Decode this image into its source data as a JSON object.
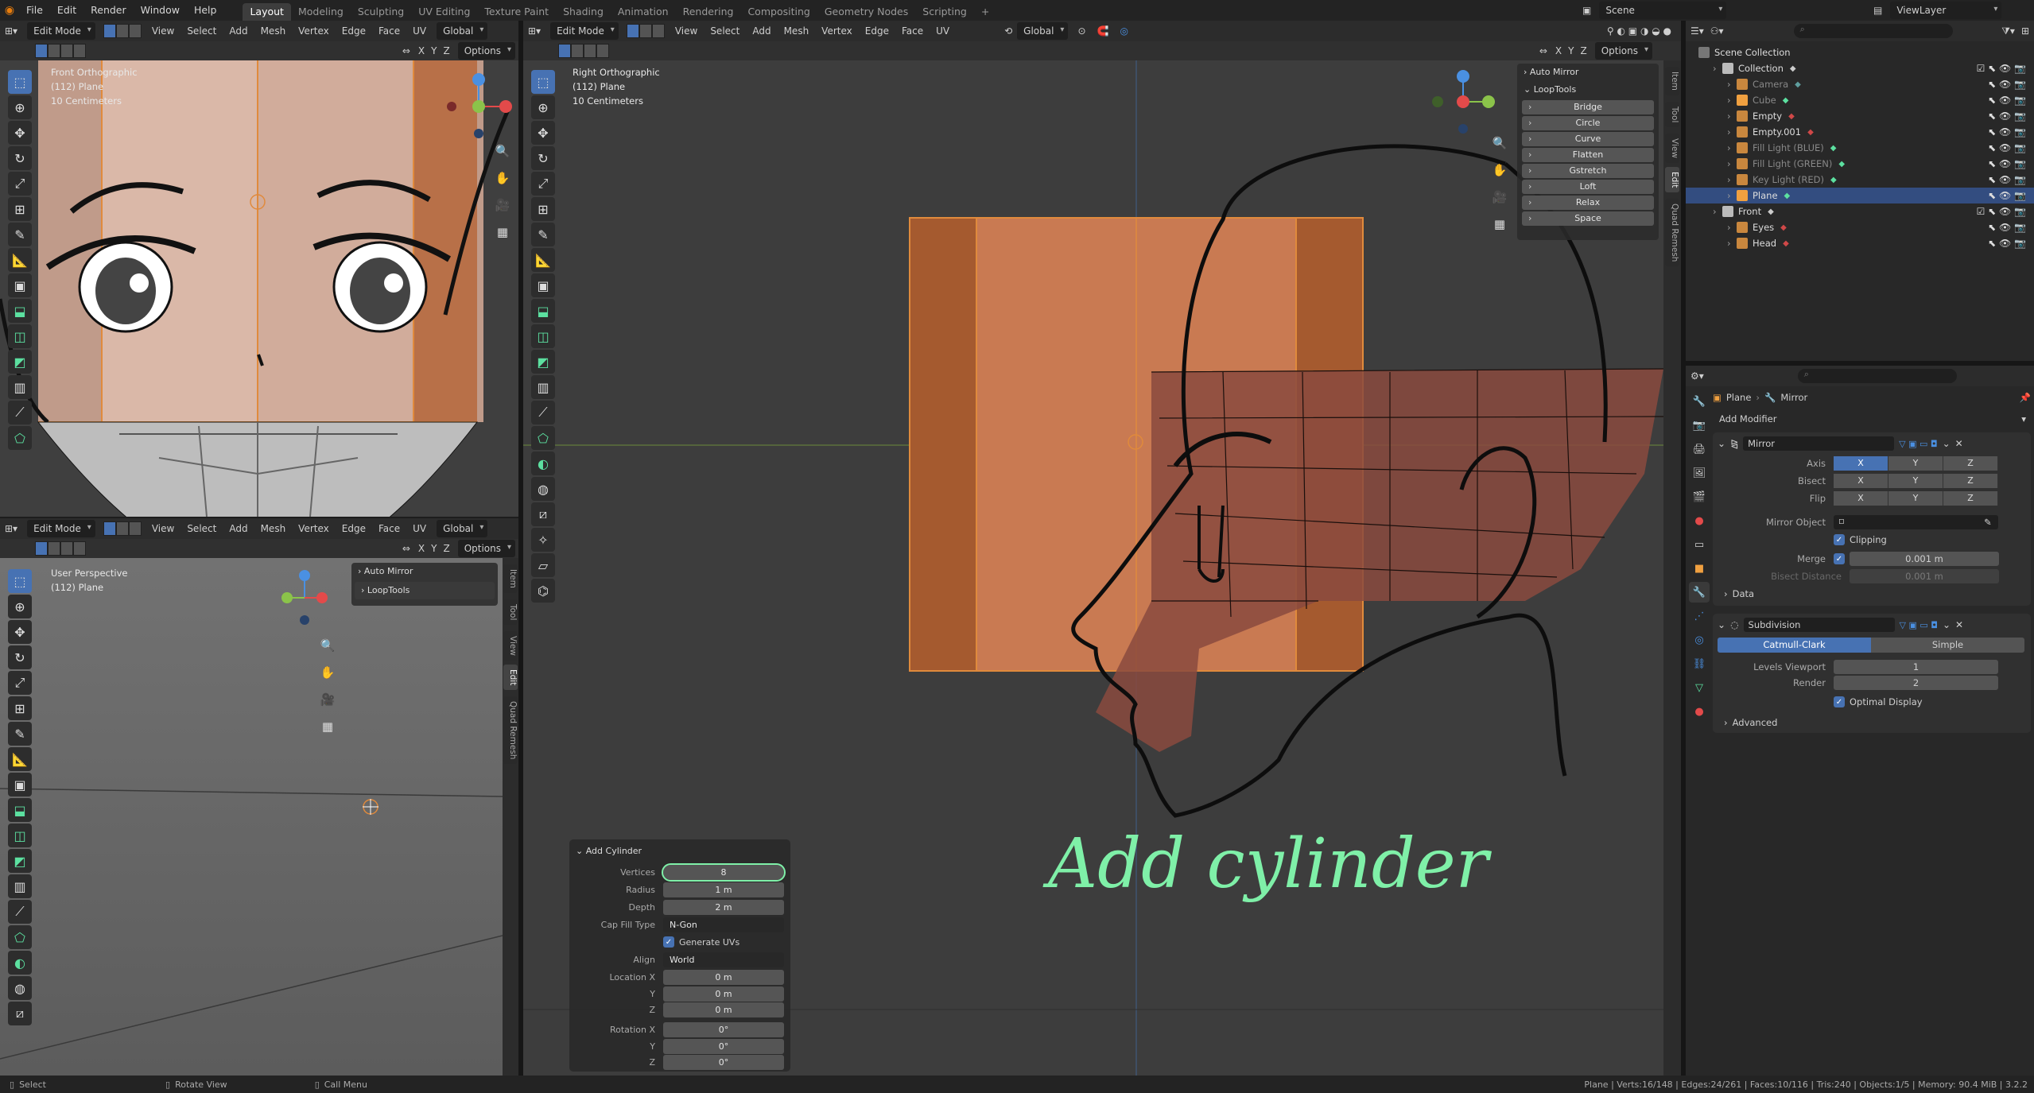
{
  "app": {
    "menu": [
      "File",
      "Edit",
      "Render",
      "Window",
      "Help"
    ],
    "workspaces": [
      "Layout",
      "Modeling",
      "Sculpting",
      "UV Editing",
      "Texture Paint",
      "Shading",
      "Animation",
      "Rendering",
      "Compositing",
      "Geometry Nodes",
      "Scripting"
    ],
    "active_workspace": "Layout",
    "add_tab": "+",
    "scene": "Scene",
    "view_layer": "ViewLayer"
  },
  "viewport_header": {
    "mode": "Edit Mode",
    "menus": [
      "View",
      "Select",
      "Add",
      "Mesh",
      "Vertex",
      "Edge",
      "Face",
      "UV"
    ],
    "orientation": "Global",
    "options": "Options",
    "axes": [
      "X",
      "Y",
      "Z"
    ]
  },
  "viewports": {
    "front": {
      "line1": "Front Orthographic",
      "line2": "(112) Plane",
      "line3": "10 Centimeters"
    },
    "persp": {
      "line1": "User Perspective",
      "line2": "(112) Plane"
    },
    "right": {
      "line1": "Right Orthographic",
      "line2": "(112) Plane",
      "line3": "10 Centimeters"
    }
  },
  "gizmo": {
    "x": "X",
    "y": "Y",
    "z": "Z",
    "colors": {
      "x": "#e34a4a",
      "y": "#8bc34a",
      "z": "#4a90e2"
    }
  },
  "sidebar_tabs": [
    "Item",
    "Tool",
    "View",
    "Edit",
    "Quad Remesh"
  ],
  "npanel": {
    "auto_mirror": "Auto Mirror",
    "looptools": "LoopTools",
    "looptools_buttons": [
      "Bridge",
      "Circle",
      "Curve",
      "Flatten",
      "Gstretch",
      "Loft",
      "Relax",
      "Space"
    ]
  },
  "operator_panel": {
    "title": "Add Cylinder",
    "vertices": {
      "label": "Vertices",
      "value": "8"
    },
    "radius": {
      "label": "Radius",
      "value": "1 m"
    },
    "depth": {
      "label": "Depth",
      "value": "2 m"
    },
    "cap_fill": {
      "label": "Cap Fill Type",
      "value": "N-Gon"
    },
    "generate_uvs": "Generate UVs",
    "align": {
      "label": "Align",
      "value": "World"
    },
    "location": [
      {
        "label": "Location X",
        "value": "0 m"
      },
      {
        "label": "Y",
        "value": "0 m"
      },
      {
        "label": "Z",
        "value": "0 m"
      }
    ],
    "rotation": [
      {
        "label": "Rotation X",
        "value": "0°"
      },
      {
        "label": "Y",
        "value": "0°"
      },
      {
        "label": "Z",
        "value": "0°"
      }
    ]
  },
  "annotation": "Add cylinder",
  "outliner": {
    "title": "Scene Collection",
    "rows": [
      {
        "name": "Collection",
        "depth": 1,
        "kind": "collection"
      },
      {
        "name": "Camera",
        "depth": 2,
        "kind": "camera",
        "dim": true
      },
      {
        "name": "Cube",
        "depth": 2,
        "kind": "mesh",
        "dim": true
      },
      {
        "name": "Empty",
        "depth": 2,
        "kind": "empty"
      },
      {
        "name": "Empty.001",
        "depth": 2,
        "kind": "empty"
      },
      {
        "name": "Fill Light (BLUE)",
        "depth": 2,
        "kind": "light",
        "dim": true
      },
      {
        "name": "Fill Light (GREEN)",
        "depth": 2,
        "kind": "light",
        "dim": true
      },
      {
        "name": "Key Light (RED)",
        "depth": 2,
        "kind": "light",
        "dim": true
      },
      {
        "name": "Plane",
        "depth": 2,
        "kind": "mesh",
        "selected": true
      },
      {
        "name": "Front",
        "depth": 1,
        "kind": "collection"
      },
      {
        "name": "Eyes",
        "depth": 2,
        "kind": "image"
      },
      {
        "name": "Head",
        "depth": 2,
        "kind": "image"
      }
    ]
  },
  "properties": {
    "breadcrumb_object": "Plane",
    "breadcrumb_mod": "Mirror",
    "add_modifier": "Add Modifier",
    "mirror": {
      "name": "Mirror",
      "axis": "Axis",
      "bisect": "Bisect",
      "flip": "Flip",
      "xyz": [
        "X",
        "Y",
        "Z"
      ],
      "mirror_object": "Mirror Object",
      "clipping": "Clipping",
      "merge": "Merge",
      "merge_value": "0.001 m",
      "bisect_distance": "Bisect Distance",
      "bisect_value": "0.001 m",
      "data": "Data"
    },
    "subdivision": {
      "name": "Subdivision",
      "catmull": "Catmull-Clark",
      "simple": "Simple",
      "levels_viewport": "Levels Viewport",
      "levels_value": "1",
      "render": "Render",
      "render_value": "2",
      "optimal": "Optimal Display",
      "advanced": "Advanced"
    }
  },
  "status": {
    "select": "Select",
    "rotate": "Rotate View",
    "call_menu": "Call Menu",
    "stats": "Plane | Verts:16/148 | Edges:24/261 | Faces:10/116 | Tris:240 | Objects:1/5 | Memory: 90.4 MiB | 3.2.2"
  }
}
